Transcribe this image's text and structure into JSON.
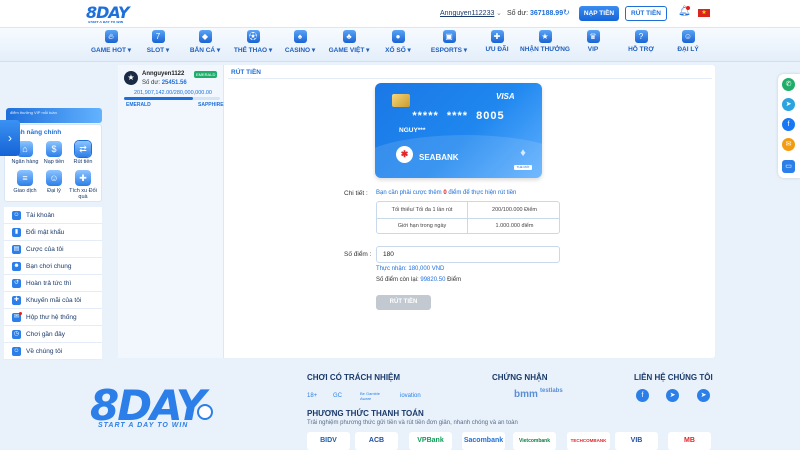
{
  "header": {
    "logo": "8DAY",
    "logo_tagline": "START A DAY TO WIN",
    "username": "Annguyen112233",
    "balance_label": "Số dư:",
    "balance_value": "367188.99",
    "deposit_label": "NẠP TIỀN",
    "withdraw_label": "RÚT TIỀN"
  },
  "nav": {
    "items": [
      {
        "label": "GAME HOT ▾",
        "icon": "game-hot-icon"
      },
      {
        "label": "SLOT ▾",
        "icon": "slot-icon"
      },
      {
        "label": "BẮN CÁ ▾",
        "icon": "fish-icon"
      },
      {
        "label": "THỂ THAO ▾",
        "icon": "sports-icon"
      },
      {
        "label": "CASINO ▾",
        "icon": "casino-icon"
      },
      {
        "label": "GAME VIỆT ▾",
        "icon": "game-viet-icon"
      },
      {
        "label": "XỔ SỐ ▾",
        "icon": "lottery-icon"
      },
      {
        "label": "ESPORTS ▾",
        "icon": "esports-icon"
      },
      {
        "label": "ƯU ĐÃI",
        "icon": "gift-icon"
      },
      {
        "label": "NHẬN THƯỞNG",
        "icon": "reward-icon"
      },
      {
        "label": "VIP",
        "icon": "vip-icon"
      },
      {
        "label": "HỖ TRỢ",
        "icon": "support-icon"
      },
      {
        "label": "ĐẠI LÝ",
        "icon": "agent-icon"
      }
    ]
  },
  "profile": {
    "name": "Annguyen1122",
    "rank_badge": "EMERALD",
    "balance_label": "Số dư:",
    "balance_value": "25451.56",
    "progress_text": "201,907,142.00/280,000,000.00",
    "progress_fraction": 0.72,
    "rank_current": "EMERALD",
    "rank_next": "SAPPHIRE",
    "promo_text": "điểm thưởng VIP mỗi tuần"
  },
  "features": {
    "title": "Tính năng chính",
    "items": [
      {
        "label": "Ngân hàng"
      },
      {
        "label": "Nạp tiền"
      },
      {
        "label": "Rút tiền"
      },
      {
        "label": "Giao dịch"
      },
      {
        "label": "Đại lý"
      },
      {
        "label": "Tích xu Đổi quà"
      }
    ]
  },
  "menu": {
    "items": [
      {
        "label": "Tài khoản"
      },
      {
        "label": "Đổi mật khẩu"
      },
      {
        "label": "Cược của tôi"
      },
      {
        "label": "Bạn chơi chung"
      },
      {
        "label": "Hoàn trả tức thì"
      },
      {
        "label": "Khuyến mãi của tôi"
      },
      {
        "label": "Hộp thư hệ thống"
      },
      {
        "label": "Chơi gần đây"
      },
      {
        "label": "Về chúng tôi"
      }
    ]
  },
  "withdraw": {
    "title": "RÚT TIỀN",
    "card": {
      "brand": "VISA",
      "number": "*****  ****  8005",
      "holder": "NGUY***",
      "bank": "SEABANK",
      "bank_tag": "THẺ MỚI"
    },
    "detail_label": "Chi tiết :",
    "note_prefix": "Bạn cần phải cược thêm",
    "note_amount": "0",
    "note_suffix": "điểm để thực hiện rút tiền",
    "limits": [
      {
        "key": "Tối thiểu/ Tối đa 1 lần rút",
        "value": "200/100.000 Điểm"
      },
      {
        "key": "Giới hạn trong ngày",
        "value": "1.000.000 điểm"
      }
    ],
    "amount_label": "Số điểm :",
    "amount_value": "180",
    "actual_received": "Thực nhận: 180,000 VND",
    "remaining_label": "Số điểm còn lại:",
    "remaining_value": "99820.50",
    "remaining_unit": "Điểm",
    "submit_label": "RÚT TIỀN"
  },
  "footer": {
    "logo": "8DAY",
    "slogan": "START A DAY TO WIN",
    "responsible_title": "CHƠI CÓ TRÁCH NHIỆM",
    "responsible_items": [
      "18+",
      "GC",
      "Be Gamble Aware",
      "iovation"
    ],
    "cert_title": "CHỨNG NHẬN",
    "cert_items": [
      "bmm",
      "testlabs"
    ],
    "contact_title": "LIÊN HỆ CHÚNG TÔI",
    "payment_title": "PHƯƠNG THỨC THANH TOÁN",
    "payment_sub": "Trải nghiệm phương thức gửi tiền và rút tiền đơn giản, nhanh chóng và an toàn",
    "banks": [
      "BIDV",
      "ACB",
      "VPBank",
      "Sacombank",
      "Vietcombank",
      "TECHCOMBANK",
      "VIB",
      "MB"
    ]
  },
  "colors": {
    "accent": "#1e6fd9",
    "nav_text": "#1e5fbf",
    "page_bg": "#e9f2fb",
    "danger": "#e02020"
  }
}
